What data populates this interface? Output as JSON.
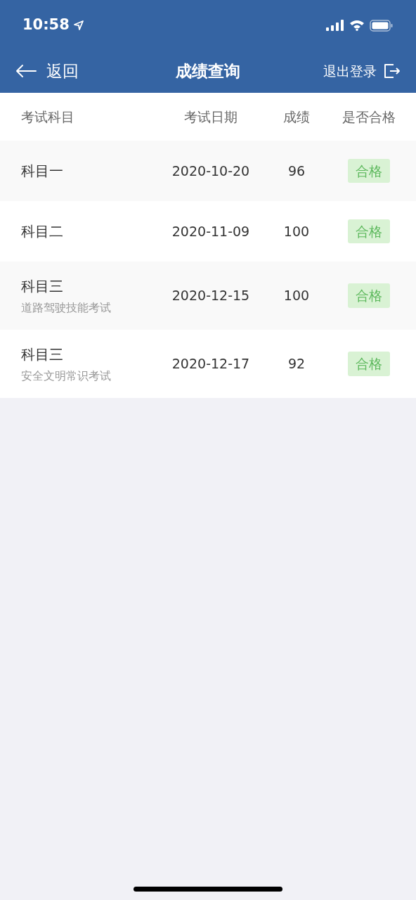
{
  "status_bar": {
    "time": "10:58"
  },
  "nav": {
    "back": "返回",
    "title": "成绩查询",
    "logout": "退出登录"
  },
  "table": {
    "columns": [
      "考试科目",
      "考试日期",
      "成绩",
      "是否合格"
    ],
    "rows": [
      {
        "subject": "科目一",
        "date": "2020-10-20",
        "score": "96",
        "result": "合格",
        "passed": true
      },
      {
        "subject": "科目二",
        "date": "2020-11-09",
        "score": "100",
        "result": "合格",
        "passed": true
      },
      {
        "subject": "科目三",
        "subtitle": "道路驾驶技能考试",
        "date": "2020-12-15",
        "score": "100",
        "result": "合格",
        "passed": true
      },
      {
        "subject": "科目三",
        "subtitle": "安全文明常识考试",
        "date": "2020-12-17",
        "score": "92",
        "result": "合格",
        "passed": true
      }
    ]
  }
}
